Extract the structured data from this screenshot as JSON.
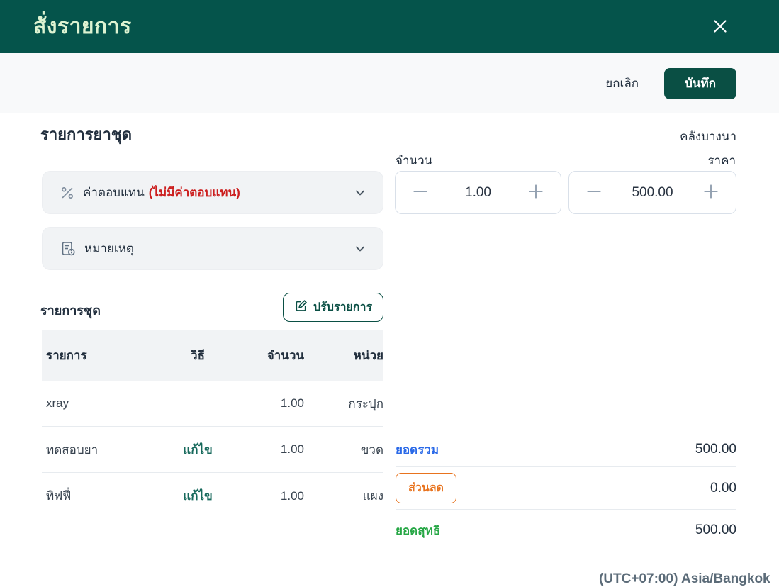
{
  "header": {
    "title": "สั่งรายการ"
  },
  "toolbar": {
    "cancel_label": "ยกเลิก",
    "save_label": "บันทึก"
  },
  "main": {
    "section_title": "รายการยาชุด",
    "warehouse": "คลังบางนา",
    "quantity": {
      "label": "จำนวน",
      "value": "1.00"
    },
    "price": {
      "label": "ราคา",
      "value": "500.00"
    },
    "panels": {
      "compensation": {
        "label": "ค่าตอบแทน",
        "note": "(ไม่มีค่าตอบแทน)"
      },
      "remark": {
        "label": "หมายเหตุ"
      }
    },
    "set_items": {
      "title": "รายการชุด",
      "adjust_button": "ปรับรายการ",
      "table": {
        "headers": [
          "รายการ",
          "วิธี",
          "จำนวน",
          "หน่วย"
        ],
        "rows": [
          {
            "item": "xray",
            "method": "",
            "qty": "1.00",
            "unit": "กระปุก"
          },
          {
            "item": "ทดสอบยา",
            "method": "แก้ไข",
            "qty": "1.00",
            "unit": "ขวด"
          },
          {
            "item": "ทิฟฟี่",
            "method": "แก้ไข",
            "qty": "1.00",
            "unit": "แผง"
          }
        ]
      }
    },
    "totals": {
      "subtotal_label": "ยอดรวม",
      "subtotal_value": "500.00",
      "discount_label": "ส่วนลด",
      "discount_value": "0.00",
      "net_label": "ยอดสุทธิ",
      "net_value": "500.00"
    }
  },
  "footer": {
    "timezone": "(UTC+07:00) Asia/Bangkok"
  },
  "colors": {
    "brand_green": "#05544b",
    "button_green": "#0a4f44",
    "title_text": "#ddf3d1",
    "alert_red": "#cc1f1f",
    "subtotal_blue": "#2b6ae8",
    "discount_orange": "#e8731e",
    "net_green": "#27a746",
    "edit_link_green": "#17695c"
  }
}
